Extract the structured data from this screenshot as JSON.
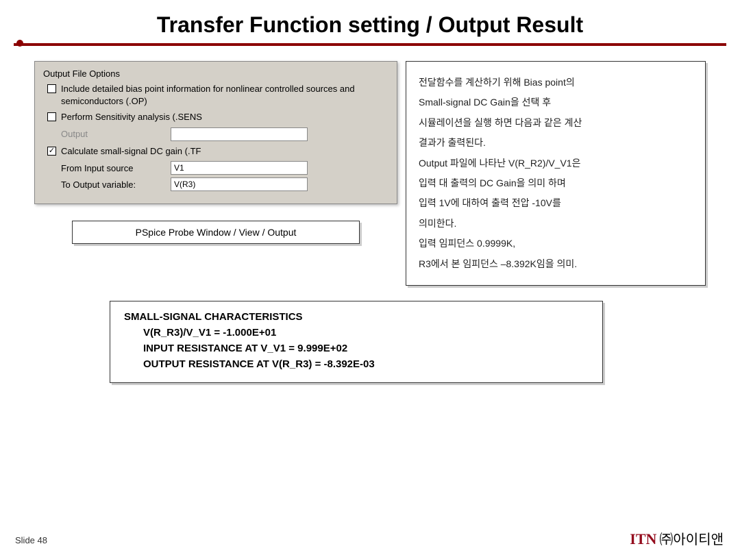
{
  "title": "Transfer Function setting / Output Result",
  "dialog": {
    "group_label": "Output File Options",
    "opt1": "Include detailed bias point information for nonlinear controlled sources and semiconductors (.OP)",
    "opt2": "Perform Sensitivity analysis (.SENS",
    "output_label": "Output",
    "output_value": "",
    "opt3": "Calculate small-signal DC gain (.TF",
    "from_label": "From Input source",
    "from_value": "V1",
    "to_label": "To Output variable:",
    "to_value": "V(R3)"
  },
  "caption": "PSpice Probe Window / View / Output",
  "desc": {
    "l1": "전달함수를 계산하기 위해 Bias point의",
    "l2": "Small-signal DC Gain을 선택 후",
    "l3": "시뮬레이션을 실행 하면 다음과 같은 계산",
    "l4": "결과가 출력된다.",
    "l5": "Output 파일에 나타난 V(R_R2)/V_V1은",
    "l6": "입력 대 출력의 DC Gain을 의미 하며",
    "l7": "입력 1V에 대하여 출력 전압 -10V를",
    "l8": "의미한다.",
    "l9": "입력 임피던스 0.9999K,",
    "l10": "R3에서 본 임피던스 –8.392K임을 의미."
  },
  "results": {
    "heading": "SMALL-SIGNAL CHARACTERISTICS",
    "r1": "V(R_R3)/V_V1 =  -1.000E+01",
    "r2": "INPUT RESISTANCE AT V_V1 =  9.999E+02",
    "r3": "OUTPUT RESISTANCE AT V(R_R3) = -8.392E-03"
  },
  "footer": "Slide 48",
  "logo_itn": "ITN",
  "logo_kr": "㈜아이티앤"
}
